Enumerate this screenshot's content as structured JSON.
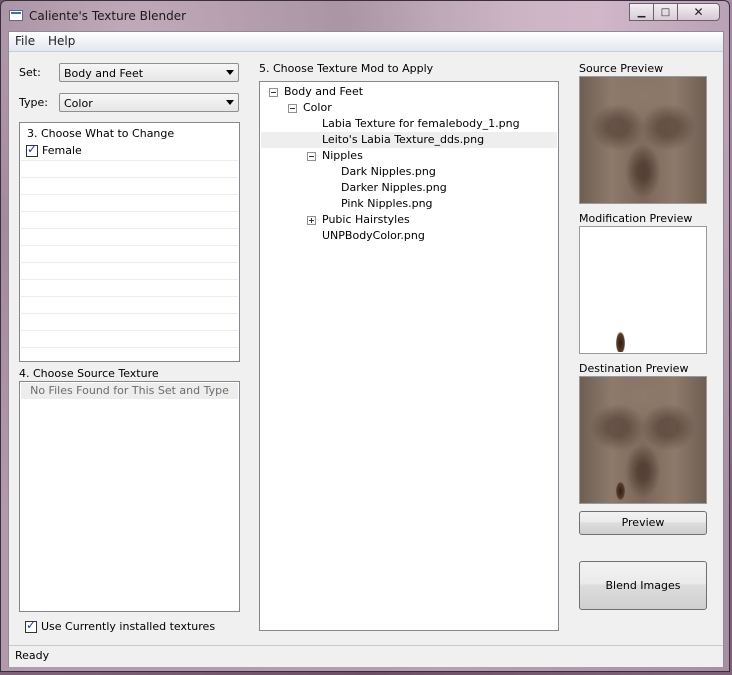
{
  "window": {
    "title": "Caliente's Texture Blender"
  },
  "menu": [
    "File",
    "Help"
  ],
  "set": {
    "label": "Set:",
    "value": "Body and Feet"
  },
  "type": {
    "label": "Type:",
    "value": "Color"
  },
  "choose_change": {
    "title": "3. Choose What to Change",
    "items": [
      {
        "label": "Female",
        "checked": true
      }
    ]
  },
  "source_texture": {
    "title": "4. Choose Source Texture",
    "empty_text": "No Files Found for This Set and Type"
  },
  "use_installed": {
    "label": "Use Currently installed textures",
    "checked": true
  },
  "mod_tree": {
    "title": "5. Choose Texture Mod to Apply",
    "nodes": [
      {
        "text": "Body and Feet",
        "expander": "minus"
      },
      {
        "text": "Color",
        "expander": "minus"
      },
      {
        "text": "Labia Texture for femalebody_1.png"
      },
      {
        "text": "Leito's Labia Texture_dds.png",
        "highlighted": true
      },
      {
        "text": "Nipples",
        "expander": "minus"
      },
      {
        "text": "Dark Nipples.png"
      },
      {
        "text": "Darker Nipples.png"
      },
      {
        "text": "Pink Nipples.png"
      },
      {
        "text": "Pubic Hairstyles",
        "expander": "plus"
      },
      {
        "text": "UNPBodyColor.png"
      }
    ]
  },
  "previews": {
    "source": "Source Preview",
    "modification": "Modification Preview",
    "destination": "Destination Preview"
  },
  "buttons": {
    "preview": "Preview",
    "blend": "Blend Images"
  },
  "status": "Ready"
}
